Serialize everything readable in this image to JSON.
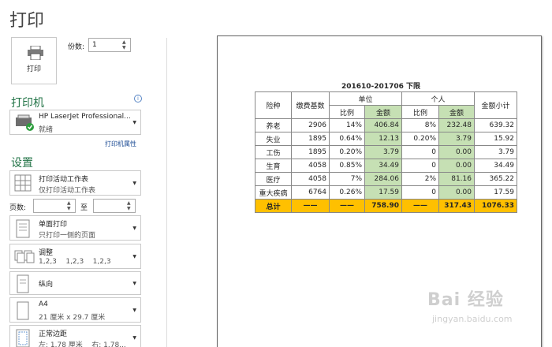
{
  "title": "打印",
  "print_button": {
    "label": "打印",
    "icon": "printer-icon"
  },
  "copies": {
    "label": "份数:",
    "value": "1"
  },
  "printer_section": {
    "heading": "打印机",
    "name": "HP LaserJet Professional...",
    "status": "就绪",
    "properties_link": "打印机属性",
    "info_icon": "info-icon"
  },
  "settings_section": {
    "heading": "设置",
    "items": [
      {
        "title": "打印活动工作表",
        "subtitle": "仅打印活动工作表",
        "icon": "sheets-icon"
      },
      {
        "title": "单面打印",
        "subtitle": "只打印一侧的页面",
        "icon": "one-sided-icon"
      },
      {
        "title": "调整",
        "subtitle": "1,2,3    1,2,3    1,2,3",
        "icon": "collate-icon"
      },
      {
        "title": "纵向",
        "subtitle": "",
        "icon": "portrait-icon"
      },
      {
        "title": "A4",
        "subtitle": "21 厘米 x 29.7 厘米",
        "icon": "paper-size-icon"
      },
      {
        "title": "正常边距",
        "subtitle": "左: 1.78 厘米    右: 1.78...",
        "icon": "margins-icon"
      }
    ],
    "pages_label": "页数:",
    "to_label": "至"
  },
  "report": {
    "title": "201610-201706 下限",
    "headers": {
      "type": "险种",
      "base": "缴费基数",
      "unit": "单位",
      "personal": "个人",
      "ratio": "比例",
      "amount": "金额",
      "subtotal": "金额小计"
    },
    "rows": [
      {
        "type": "养老",
        "base": "2906",
        "unit_ratio": "14%",
        "unit_amount": "406.84",
        "p_ratio": "8%",
        "p_amount": "232.48",
        "subtotal": "639.32"
      },
      {
        "type": "失业",
        "base": "1895",
        "unit_ratio": "0.64%",
        "unit_amount": "12.13",
        "p_ratio": "0.20%",
        "p_amount": "3.79",
        "subtotal": "15.92"
      },
      {
        "type": "工伤",
        "base": "1895",
        "unit_ratio": "0.20%",
        "unit_amount": "3.79",
        "p_ratio": "0",
        "p_amount": "0.00",
        "subtotal": "3.79"
      },
      {
        "type": "生育",
        "base": "4058",
        "unit_ratio": "0.85%",
        "unit_amount": "34.49",
        "p_ratio": "0",
        "p_amount": "0.00",
        "subtotal": "34.49"
      },
      {
        "type": "医疗",
        "base": "4058",
        "unit_ratio": "7%",
        "unit_amount": "284.06",
        "p_ratio": "2%",
        "p_amount": "81.16",
        "subtotal": "365.22"
      },
      {
        "type": "重大疾病",
        "base": "6764",
        "unit_ratio": "0.26%",
        "unit_amount": "17.59",
        "p_ratio": "0",
        "p_amount": "0.00",
        "subtotal": "17.59"
      }
    ],
    "total": {
      "type": "总计",
      "base": "——",
      "unit_ratio": "——",
      "unit_amount": "758.90",
      "p_ratio": "——",
      "p_amount": "317.43",
      "subtotal": "1076.33"
    }
  },
  "watermark": {
    "text": "Bai 经验",
    "url": "jingyan.baidu.com"
  },
  "colors": {
    "accent": "#217346",
    "green_cell": "#c6e0b4",
    "total_row": "#ffc000",
    "link": "#1f4e96"
  }
}
